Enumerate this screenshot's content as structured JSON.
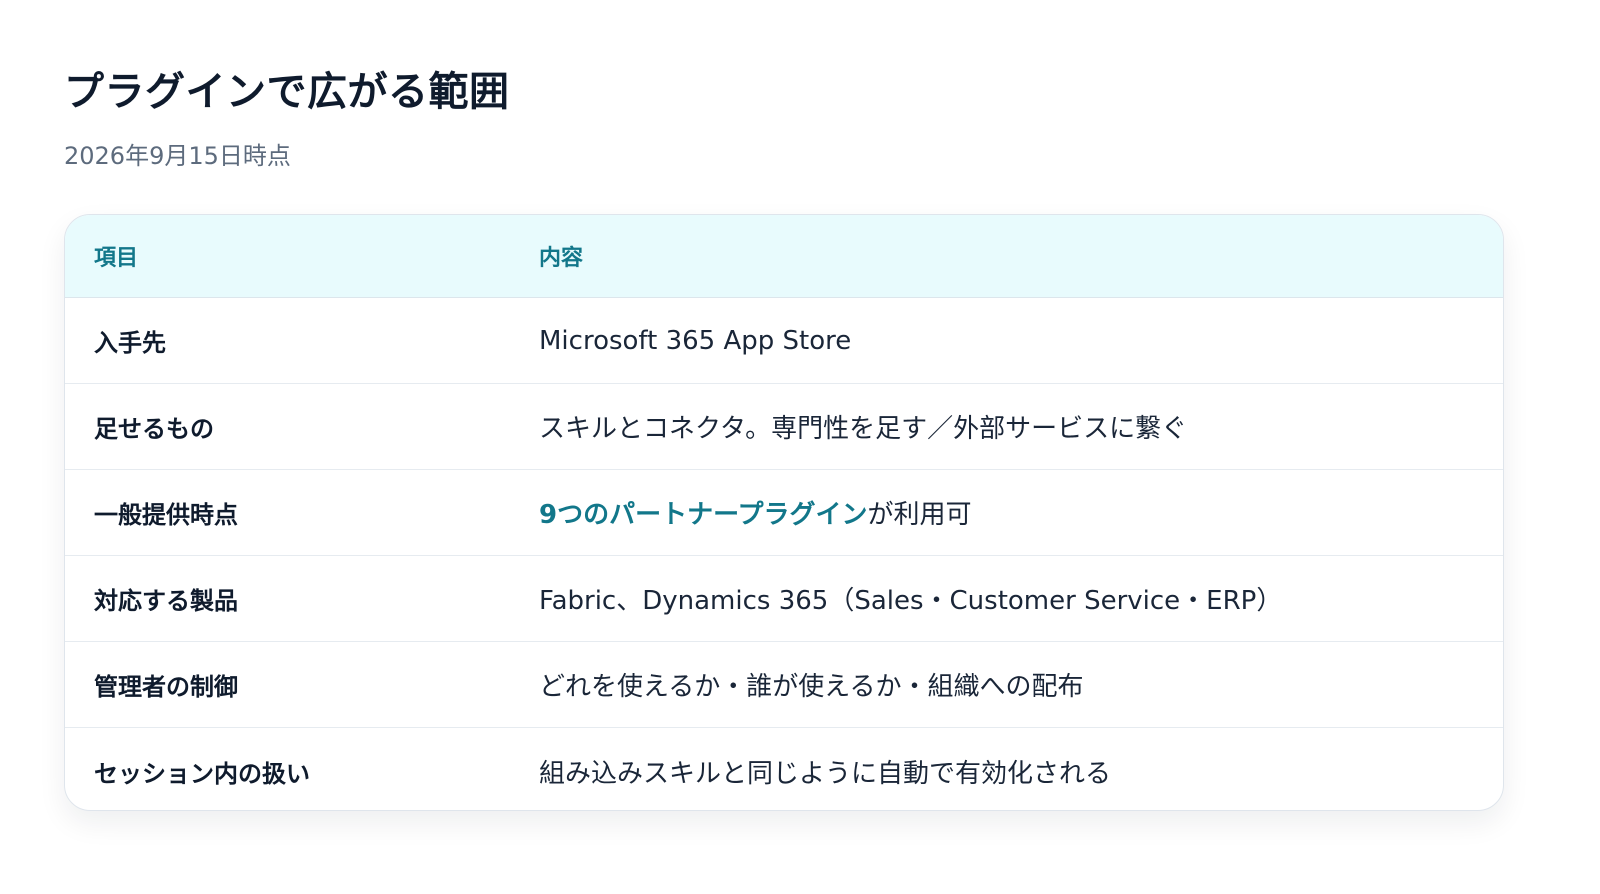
{
  "title": "プラグインで広がる範囲",
  "subtitle": "2026年9月15日時点",
  "table": {
    "headers": [
      "項目",
      "内容"
    ],
    "rows": [
      {
        "key": "入手先",
        "value_highlight": "",
        "value": "Microsoft 365 App Store"
      },
      {
        "key": "足せるもの",
        "value_highlight": "",
        "value": "スキルとコネクタ。専門性を足す／外部サービスに繋ぐ"
      },
      {
        "key": "一般提供時点",
        "value_highlight": "9つのパートナープラグイン",
        "value": "が利用可"
      },
      {
        "key": "対応する製品",
        "value_highlight": "",
        "value": "Fabric、Dynamics 365（Sales・Customer Service・ERP）"
      },
      {
        "key": "管理者の制御",
        "value_highlight": "",
        "value": "どれを使えるか・誰が使えるか・組織への配布"
      },
      {
        "key": "セッション内の扱い",
        "value_highlight": "",
        "value": "組み込みスキルと同じように自動で有効化される"
      }
    ]
  },
  "colors": {
    "accent": "#12778a",
    "header_bg": "#e8fbfd",
    "text": "#0f1b2d",
    "muted": "#5d6b7d"
  }
}
